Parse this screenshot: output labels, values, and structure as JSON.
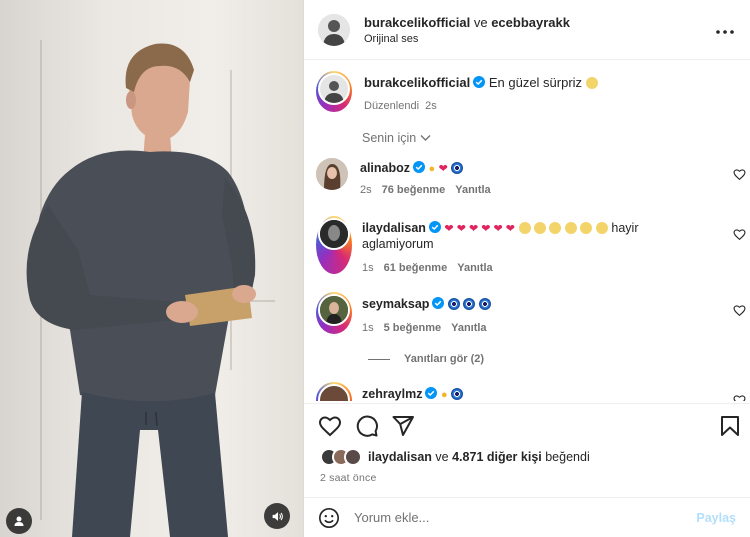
{
  "header": {
    "author": "burakcelikofficial",
    "joiner": "ve",
    "coauthor": "ecebbayrakk",
    "audio": "Orijinal ses"
  },
  "caption": {
    "username": "burakcelikofficial",
    "text": "En güzel sürpriz",
    "edited": "Düzenlendi",
    "age": "2s"
  },
  "filter": {
    "label": "Senin için"
  },
  "comments": [
    {
      "username": "alinaboz",
      "age": "2s",
      "likes": "76 beğenme",
      "reply": "Yanıtla"
    },
    {
      "username": "ilaydalisan",
      "text_suffix": "hayir",
      "text_line2": "aglamiyorum",
      "age": "1s",
      "likes": "61 beğenme",
      "reply": "Yanıtla"
    },
    {
      "username": "seymaksap",
      "age": "1s",
      "likes": "5 beğenme",
      "reply": "Yanıtla"
    },
    {
      "username": "zehraylmz"
    }
  ],
  "view_replies": "Yanıtları gör (2)",
  "likes": {
    "first_user": "ilaydalisan",
    "joiner": "ve",
    "others": "4.871 diğer kişi",
    "suffix": "beğendi"
  },
  "time": "2 saat önce",
  "composer": {
    "placeholder": "Yorum ekle...",
    "post_label": "Paylaş"
  },
  "icons": [
    "user-icon",
    "volume-icon",
    "more-icon",
    "verified-icon",
    "heart-icon",
    "comment-icon",
    "share-icon",
    "bookmark-icon",
    "emoji-icon",
    "chevron-down-icon"
  ],
  "colors": {
    "verified": "#0095f6",
    "post_disabled": "#b2dffc",
    "secondary_text": "#737373"
  }
}
